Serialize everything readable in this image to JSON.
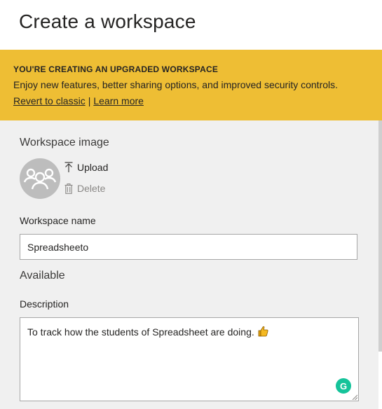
{
  "header": {
    "title": "Create a workspace"
  },
  "banner": {
    "heading": "YOU'RE CREATING AN UPGRADED WORKSPACE",
    "text": "Enjoy new features, better sharing options, and improved security controls.",
    "revert_link": "Revert to classic",
    "separator": "|",
    "learn_more_link": "Learn more",
    "background_color": "#eebe34"
  },
  "form": {
    "image_section_label": "Workspace image",
    "upload_label": "Upload",
    "delete_label": "Delete",
    "name_label": "Workspace name",
    "name_value": "Spreadsheeto",
    "availability": "Available",
    "description_label": "Description",
    "description_value": "To track how the students of Spreadsheet are doing.",
    "grammarly_badge": "G"
  },
  "icons": {
    "avatar": "group-people-icon",
    "upload": "upload-arrow-icon",
    "delete": "trash-icon",
    "emoji": "thumbs-up-emoji",
    "grammarly": "grammarly-icon"
  }
}
